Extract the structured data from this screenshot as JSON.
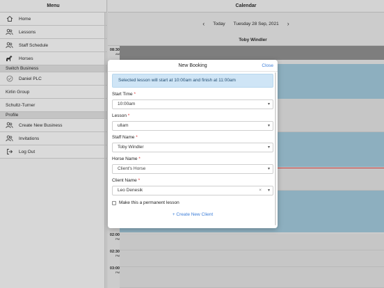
{
  "sidebar": {
    "title": "Menu",
    "items": [
      {
        "label": "Home",
        "icon": "home-icon"
      },
      {
        "label": "Lessons",
        "icon": "users-icon"
      },
      {
        "label": "Staff Schedule",
        "icon": "users-icon"
      },
      {
        "label": "Horses",
        "icon": "horse-icon"
      }
    ],
    "switch_business": {
      "title": "Switch Business",
      "items": [
        {
          "label": "Daniel PLC",
          "selected": true
        },
        {
          "label": "Kirlin Group"
        },
        {
          "label": "Schultz-Turner"
        }
      ]
    },
    "profile": {
      "title": "Profile",
      "items": [
        {
          "label": "Create New Business",
          "icon": "users-icon"
        },
        {
          "label": "Invitations",
          "icon": "users-icon"
        },
        {
          "label": "Log Out",
          "icon": "logout-icon"
        }
      ]
    }
  },
  "calendar": {
    "title": "Calendar",
    "today_label": "Today",
    "date": "Tuesday 28 Sep, 2021",
    "column_title": "Toby Windler",
    "times": [
      {
        "time": "08:30",
        "ampm": "AM"
      },
      {
        "time": "02:00",
        "ampm": "PM"
      },
      {
        "time": "02:30",
        "ampm": "PM"
      },
      {
        "time": "03:00",
        "ampm": "PM"
      }
    ]
  },
  "modal": {
    "title": "New Booking",
    "close_label": "Close",
    "info": "Selected lesson will start at 10:00am and finish at 11:00am",
    "start_time": {
      "label": "Start Time",
      "required": "*",
      "value": "10:00am"
    },
    "lesson": {
      "label": "Lesson",
      "required": "*",
      "value": "ullam"
    },
    "staff": {
      "label": "Staff Name",
      "required": "*",
      "value": "Toby Windler"
    },
    "horse": {
      "label": "Horse Name",
      "required": "*",
      "placeholder": "Client's Horse"
    },
    "client": {
      "label": "Client Name",
      "required": "*",
      "value": "Leo Denesik",
      "clear_glyph": "×"
    },
    "permanent_label": "Make this a permanent lesson",
    "create_client_label": "Create New Client",
    "create_client_glyph": "+"
  },
  "colors": {
    "accent": "#3b7dd8",
    "info_bg": "#cfe5f6",
    "event_blue": "#9cc4d6",
    "now_line": "#dd3333"
  }
}
